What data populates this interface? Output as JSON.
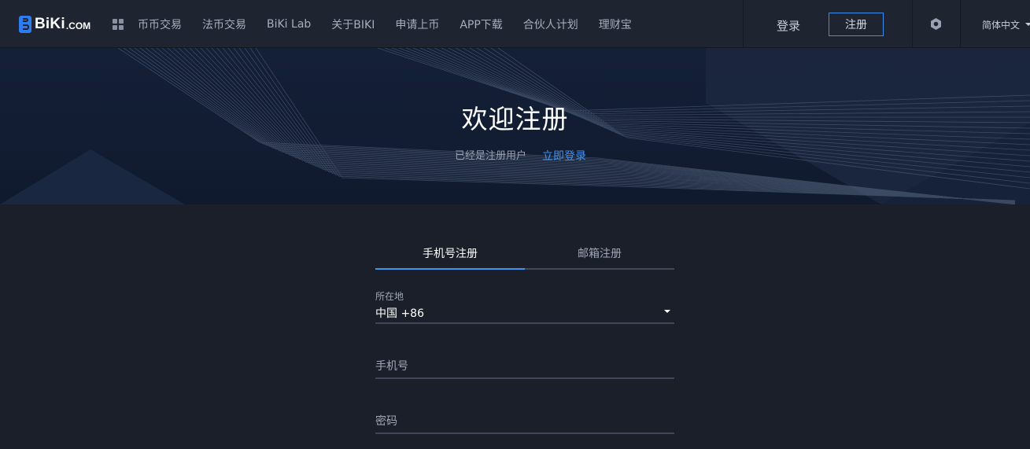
{
  "brand": {
    "logo_text": "BiKi",
    "logo_domain": ".COM"
  },
  "nav": {
    "items": [
      {
        "label": "币币交易"
      },
      {
        "label": "法币交易"
      },
      {
        "label": "BiKi Lab"
      },
      {
        "label": "关于BIKI"
      },
      {
        "label": "申请上币"
      },
      {
        "label": "APP下载"
      },
      {
        "label": "合伙人计划"
      },
      {
        "label": "理财宝"
      }
    ],
    "login_label": "登录",
    "register_label": "注册",
    "language": "简体中文",
    "icons": {
      "apps": "grid-icon",
      "settings": "hexagon-settings-icon",
      "language_dropdown": "caret-down-icon"
    }
  },
  "hero": {
    "title": "欢迎注册",
    "subtitle": "已经是注册用户",
    "login_link": "立即登录"
  },
  "form": {
    "tabs": [
      {
        "label": "手机号注册",
        "active": true
      },
      {
        "label": "邮箱注册",
        "active": false
      }
    ],
    "location": {
      "label": "所在地",
      "value": "中国 +86"
    },
    "phone": {
      "placeholder": "手机号",
      "value": ""
    },
    "password": {
      "placeholder": "密码",
      "value": ""
    }
  },
  "colors": {
    "accent": "#3d95f4",
    "page_bg": "#1b1f2a",
    "nav_bg": "#1f2431",
    "hero_bg": "#142038"
  }
}
